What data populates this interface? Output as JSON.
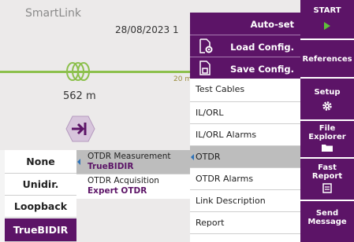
{
  "app": {
    "title": "SmartLink",
    "date": "28/08/2023 1"
  },
  "link_view": {
    "fiber_length": "562 m",
    "event_distance": "20 m"
  },
  "dropdown": {
    "items": [
      {
        "label": "Auto-set",
        "icon": "none"
      },
      {
        "label": "Load Config.",
        "icon": "file-gear-icon"
      },
      {
        "label": "Save Config.",
        "icon": "file-save-icon"
      }
    ]
  },
  "setup_menu": {
    "items": [
      {
        "label": "Test Cables",
        "selected": false
      },
      {
        "label": "IL/ORL",
        "selected": false
      },
      {
        "label": "IL/ORL Alarms",
        "selected": false
      },
      {
        "label": "OTDR",
        "selected": true
      },
      {
        "label": "OTDR Alarms",
        "selected": false
      },
      {
        "label": "Link Description",
        "selected": false
      },
      {
        "label": "Report",
        "selected": false
      }
    ]
  },
  "otdr_menu": {
    "items": [
      {
        "label": "OTDR Measurement",
        "value": "TrueBIDIR",
        "selected": true
      },
      {
        "label": "OTDR Acquisition",
        "value": "Expert OTDR",
        "selected": false
      }
    ]
  },
  "mode_menu": {
    "items": [
      {
        "label": "None",
        "selected": false
      },
      {
        "label": "Unidir.",
        "selected": false
      },
      {
        "label": "Loopback",
        "selected": false
      },
      {
        "label": "TrueBIDIR",
        "selected": true
      }
    ]
  },
  "sidebar": {
    "start": "START",
    "references": "References",
    "setup": "Setup",
    "file_explorer": "File\nExplorer",
    "fast_report": "Fast\nReport",
    "send_message": "Send\nMessage"
  },
  "colors": {
    "accent": "#5c1467",
    "selected": "#bdbdbd",
    "fiber": "#8cc04c",
    "play": "#5fbf3a"
  }
}
